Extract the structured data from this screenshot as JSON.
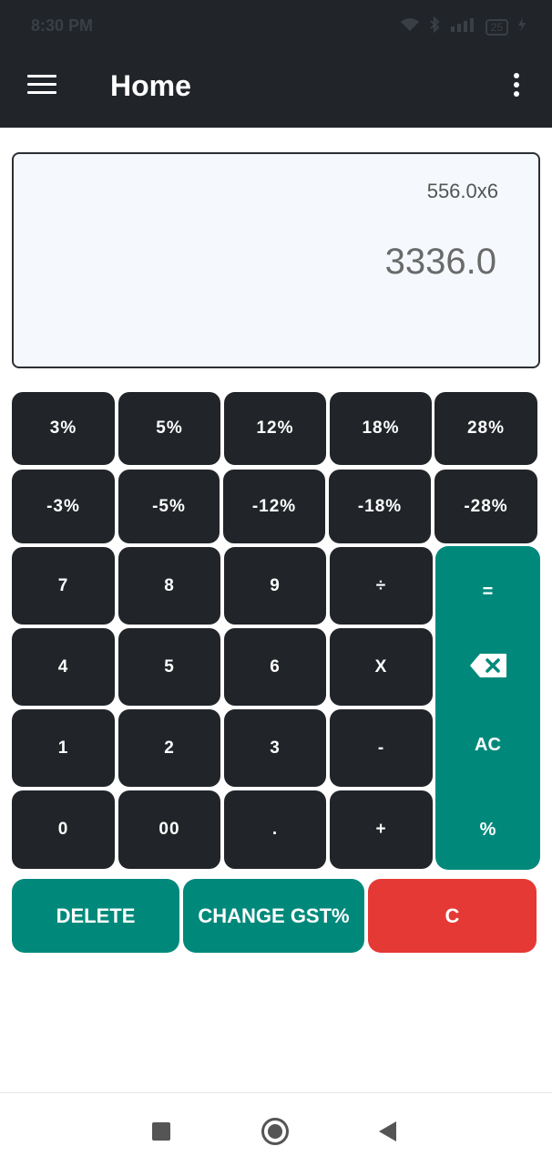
{
  "status_bar": {
    "time": "8:30 PM",
    "battery": "25"
  },
  "app_bar": {
    "title": "Home"
  },
  "display": {
    "expression": "556.0x6",
    "result": "3336.0"
  },
  "keypad": {
    "gst_plus": [
      "3%",
      "5%",
      "12%",
      "18%",
      "28%"
    ],
    "gst_minus": [
      "-3%",
      "-5%",
      "-12%",
      "-18%",
      "-28%"
    ],
    "row1": [
      "7",
      "8",
      "9",
      "÷"
    ],
    "row2": [
      "4",
      "5",
      "6",
      "X"
    ],
    "row3": [
      "1",
      "2",
      "3",
      "-"
    ],
    "row4": [
      "0",
      "00",
      ".",
      "+"
    ],
    "side": {
      "equals": "=",
      "backspace_icon": "backspace-icon",
      "all_clear": "AC",
      "percent": "%"
    }
  },
  "actions": {
    "delete": "DELETE",
    "change_gst": "CHANGE GST%",
    "clear": "C"
  },
  "colors": {
    "dark_key": "#212529",
    "teal": "#00897b",
    "red": "#e53935",
    "display_bg": "#f5f9fd"
  }
}
